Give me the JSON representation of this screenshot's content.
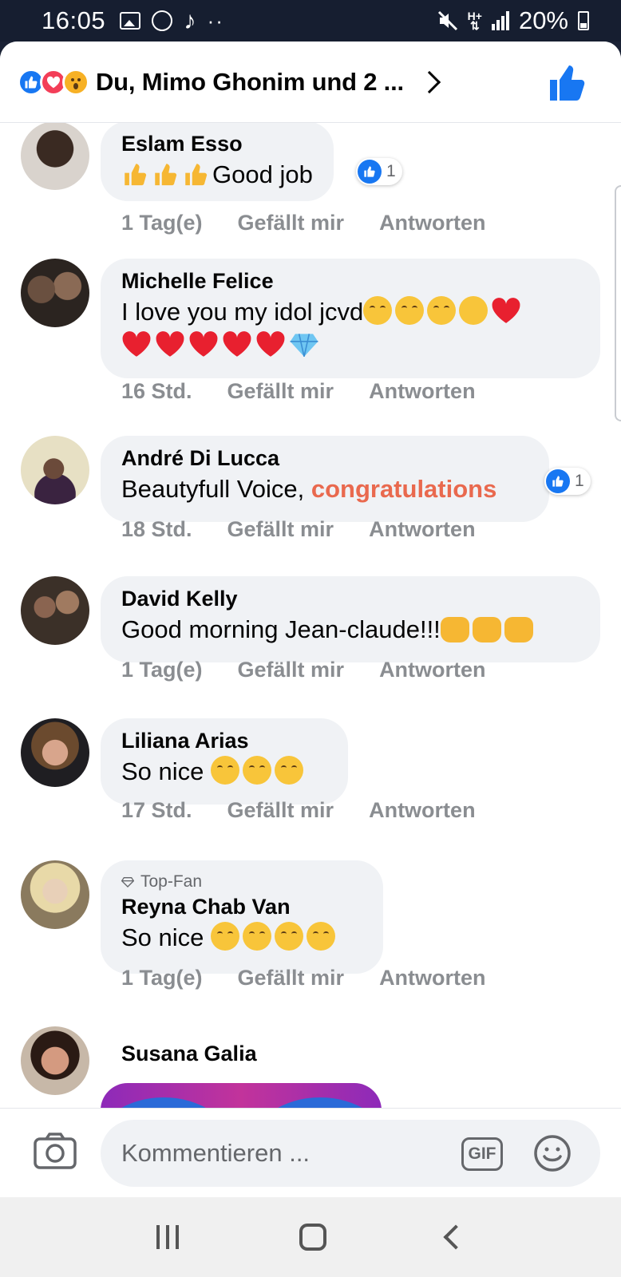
{
  "status_bar": {
    "time": "16:05",
    "battery": "20%"
  },
  "header": {
    "title": "Du, Mimo Ghonim und 2 ..."
  },
  "comments": [
    {
      "name": "Eslam Esso",
      "text": "Good job",
      "time": "1 Tag(e)",
      "like_label": "Gefällt mir",
      "reply_label": "Antworten",
      "likes": "1"
    },
    {
      "name": "Michelle Felice",
      "text": "I love you my idol jcvd",
      "time": "16 Std.",
      "like_label": "Gefällt mir",
      "reply_label": "Antworten"
    },
    {
      "name": "André Di Lucca",
      "text": "Beautyfull Voice, ",
      "highlight": "congratulations",
      "time": "18 Std.",
      "like_label": "Gefällt mir",
      "reply_label": "Antworten",
      "likes": "1"
    },
    {
      "name": "David Kelly",
      "text": "Good morning Jean-claude!!!",
      "time": "1 Tag(e)",
      "like_label": "Gefällt mir",
      "reply_label": "Antworten"
    },
    {
      "name": "Liliana Arias",
      "text": "So nice ",
      "time": "17 Std.",
      "like_label": "Gefällt mir",
      "reply_label": "Antworten"
    },
    {
      "name": "Reyna Chab Van",
      "badge": "Top-Fan",
      "text": "So nice ",
      "time": "1 Tag(e)",
      "like_label": "Gefällt mir",
      "reply_label": "Antworten"
    },
    {
      "name": "Susana Galia"
    }
  ],
  "composer": {
    "placeholder": "Kommentieren ...",
    "gif_label": "GIF"
  },
  "colors": {
    "accent": "#1877f2",
    "love": "#f33e58",
    "wow": "#f7b125",
    "highlight": "#e9694e",
    "bubble": "#f0f2f5"
  }
}
